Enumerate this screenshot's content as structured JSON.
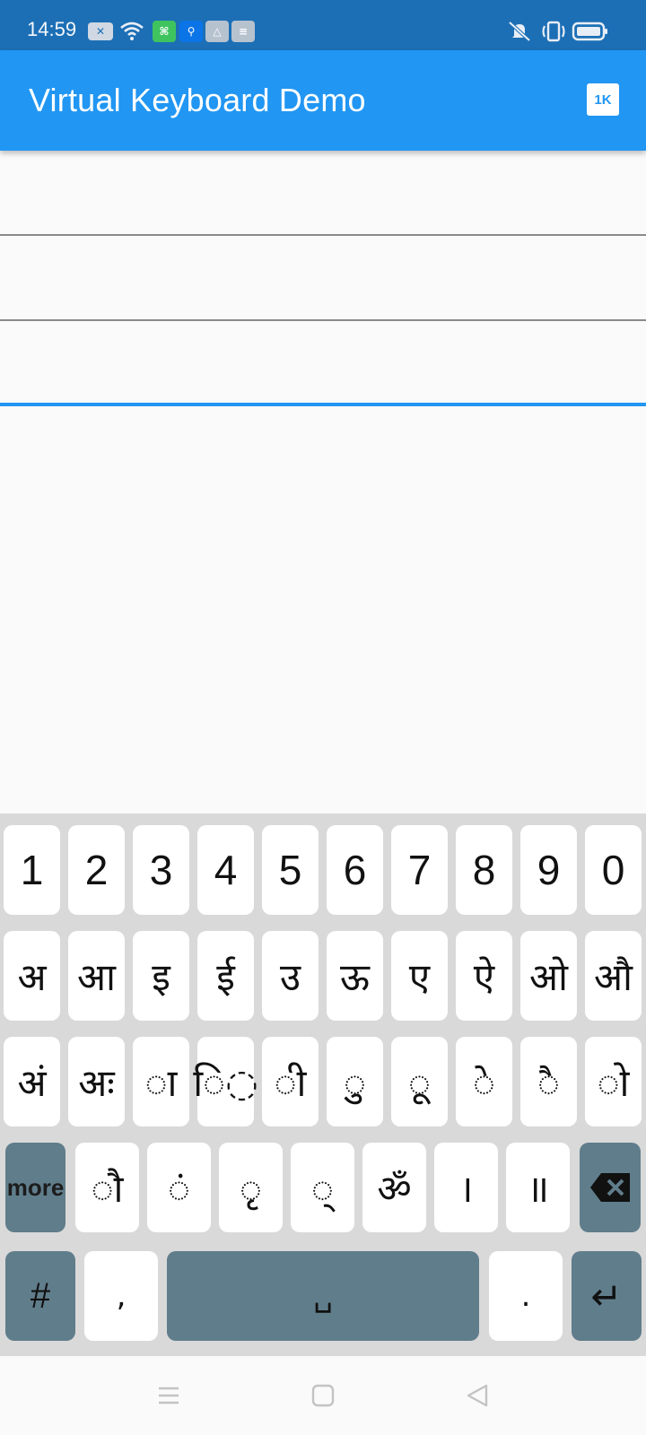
{
  "status_bar": {
    "time": "14:59",
    "icons_left": [
      "notification-x-icon",
      "wifi-icon",
      "sim-icon",
      "usb-icon",
      "shapes-icon",
      "layers-icon"
    ],
    "icons_right": [
      "vibrate-muted-icon",
      "vibrate-icon",
      "battery-icon"
    ]
  },
  "app_bar": {
    "title": "Virtual Keyboard Demo",
    "badge": "1K"
  },
  "fields": [
    {
      "value": "",
      "focused": false
    },
    {
      "value": "",
      "focused": false
    },
    {
      "value": "",
      "focused": true
    }
  ],
  "keyboard": {
    "row1": [
      "1",
      "2",
      "3",
      "4",
      "5",
      "6",
      "7",
      "8",
      "9",
      "0"
    ],
    "row2": [
      "अ",
      "आ",
      "इ",
      "ई",
      "उ",
      "ऊ",
      "ए",
      "ऐ",
      "ओ",
      "औ"
    ],
    "row3": [
      "अं",
      "अः",
      "◌ा",
      "ि◌",
      "◌ी",
      "◌ु",
      "◌ू",
      "◌े",
      "◌ै",
      "◌ो"
    ],
    "row4": [
      "more",
      "◌ौ",
      "◌ं",
      "◌ृ",
      "◌्",
      "ॐ",
      "।",
      "॥",
      "backspace"
    ],
    "row5": [
      "#",
      ",",
      "␣",
      ".",
      "enter"
    ],
    "labels": {
      "more": "more",
      "hash": "#",
      "comma": ",",
      "space": "␣",
      "period": ".",
      "enter": "↵"
    }
  },
  "nav_bar": {
    "buttons": [
      "menu-icon",
      "home-icon",
      "back-icon"
    ]
  },
  "colors": {
    "status_bar": "#1c6fb5",
    "app_bar": "#2196f3",
    "key": "#ffffff",
    "func_key": "#607d8b",
    "keyboard_bg": "#d9d9d9",
    "focus_underline": "#2196f3"
  }
}
